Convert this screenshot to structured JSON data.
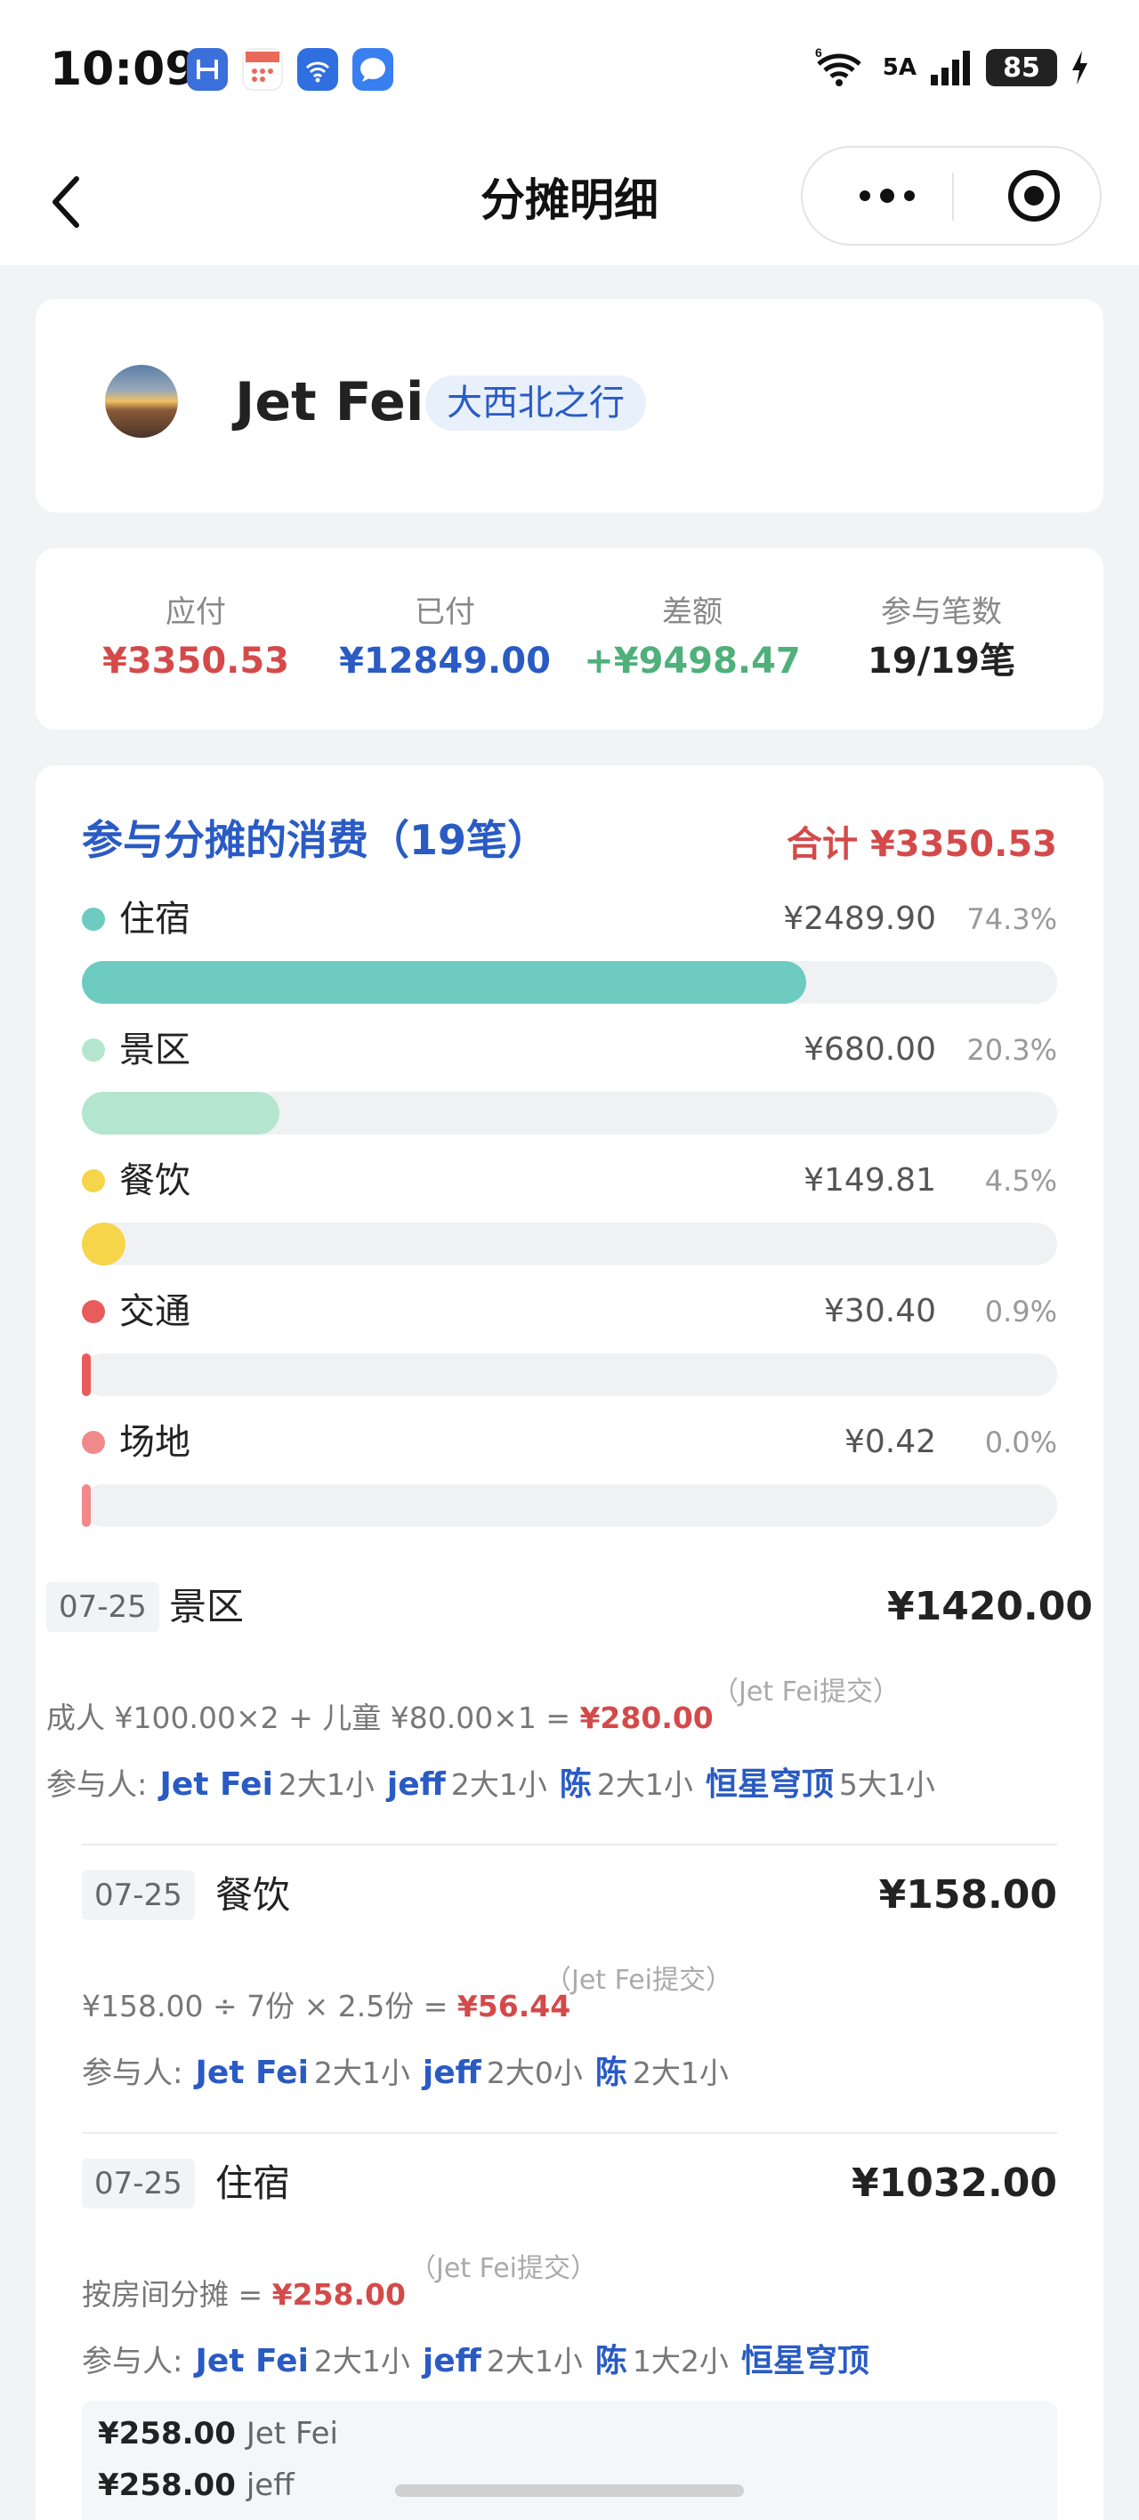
{
  "status_bar": {
    "time": "10:09",
    "network_label": "5A",
    "battery": "85",
    "apps": [
      {
        "icon": "hyper-app-icon",
        "color": "#3b6fd9"
      },
      {
        "icon": "calendar-app-icon",
        "color": "#e86a5a"
      },
      {
        "icon": "wifi-app-icon",
        "color": "#2f6fe0"
      },
      {
        "icon": "message-app-icon",
        "color": "#3a7ff0"
      }
    ]
  },
  "nav": {
    "title": "分摊明细"
  },
  "profile": {
    "name": "Jet Fei",
    "trip_tag": "大西北之行"
  },
  "summary": {
    "stats": [
      {
        "label": "应付",
        "value": "¥3350.53",
        "color": "#d44a4a"
      },
      {
        "label": "已付",
        "value": "¥12849.00",
        "color": "#2a5bc4"
      },
      {
        "label": "差额",
        "value": "+¥9498.47",
        "color": "#4fb07a"
      },
      {
        "label": "参与笔数",
        "value": "19/19笔",
        "color": "#222222"
      }
    ]
  },
  "breakdown": {
    "title": "参与分摊的消费（19笔）",
    "total": "合计 ¥3350.53",
    "categories": [
      {
        "name": "住宿",
        "amount": "¥2489.90",
        "percent": "74.3%",
        "share": 0.743,
        "color": "#6ecbc0"
      },
      {
        "name": "景区",
        "amount": "¥680.00",
        "percent": "20.3%",
        "share": 0.203,
        "color": "#b4e6cf"
      },
      {
        "name": "餐饮",
        "amount": "¥149.81",
        "percent": "4.5%",
        "share": 0.045,
        "color": "#f7d54a"
      },
      {
        "name": "交通",
        "amount": "¥30.40",
        "percent": "0.9%",
        "share": 0.009,
        "color": "#e85c5c"
      },
      {
        "name": "场地",
        "amount": "¥0.42",
        "percent": "0.0%",
        "share": 0.0,
        "color": "#f08a8a"
      }
    ]
  },
  "expenses": [
    {
      "date": "07-25",
      "category": "景区",
      "total": "¥1420.00",
      "formula": "成人 ¥100.00×2 + 儿童 ¥80.00×1 = ",
      "share": "¥280.00",
      "submitter": "（Jet Fei提交）",
      "people_label": "参与人:",
      "people": [
        {
          "name": "Jet Fei",
          "count": "2大1小"
        },
        {
          "name": "jeff",
          "count": "2大1小"
        },
        {
          "name": "陈",
          "count": "2大1小"
        },
        {
          "name": "恒星穹顶",
          "count": "5大1小"
        }
      ]
    },
    {
      "date": "07-25",
      "category": "餐饮",
      "total": "¥158.00",
      "formula": "¥158.00 ÷ 7份 × 2.5份 = ",
      "share": "¥56.44",
      "submitter": "（Jet Fei提交）",
      "people_label": "参与人:",
      "people": [
        {
          "name": "Jet Fei",
          "count": "2大1小"
        },
        {
          "name": "jeff",
          "count": "2大0小"
        },
        {
          "name": "陈",
          "count": "2大1小"
        }
      ]
    },
    {
      "date": "07-25",
      "category": "住宿",
      "total": "¥1032.00",
      "formula": "按房间分摊 = ",
      "share": "¥258.00",
      "submitter": "（Jet Fei提交）",
      "people_label": "参与人:",
      "people": [
        {
          "name": "Jet Fei",
          "count": "2大1小"
        },
        {
          "name": "jeff",
          "count": "2大1小"
        },
        {
          "name": "陈",
          "count": "1大2小"
        },
        {
          "name": "恒星穹顶",
          "count": ""
        }
      ],
      "room_split": [
        {
          "amount": "¥258.00",
          "person": "Jet Fei"
        },
        {
          "amount": "¥258.00",
          "person": "jeff"
        }
      ]
    }
  ]
}
